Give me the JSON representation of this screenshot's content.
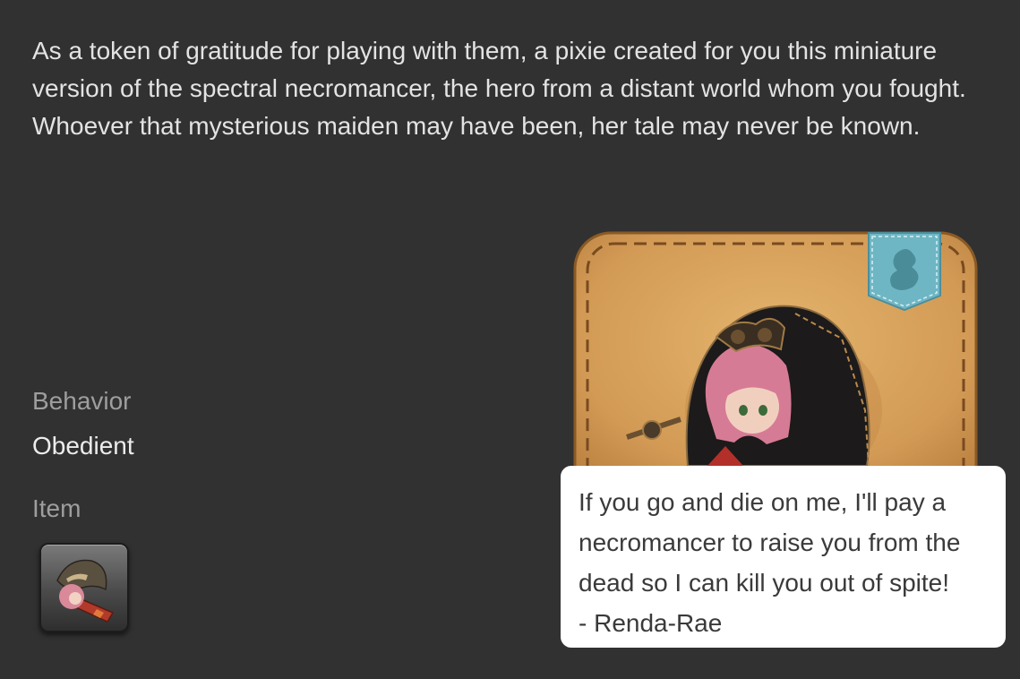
{
  "description": {
    "text": "As a token of gratitude for playing with them, a pixie created for you this miniature version of the spectral necromancer, the hero from a distant world whom you fought. Whoever that mysterious maiden may have been, her tale may never be known."
  },
  "behavior": {
    "label": "Behavior",
    "value": "Obedient"
  },
  "item": {
    "label": "Item",
    "icon": "minion-necromancer-item-icon"
  },
  "card": {
    "image": "spectral-necromancer-minion-portrait",
    "badge_icon": "chocobo-silhouette-icon",
    "colors": {
      "leather": "#d9a55e",
      "stitch": "#7a4a20",
      "badge": "#6fb6c4"
    }
  },
  "quote": {
    "lines": [
      "If you go and die on me, I'll pay a",
      "necromancer to raise you from the",
      "dead so I can kill you out of spite!",
      "- Renda-Rae"
    ]
  }
}
